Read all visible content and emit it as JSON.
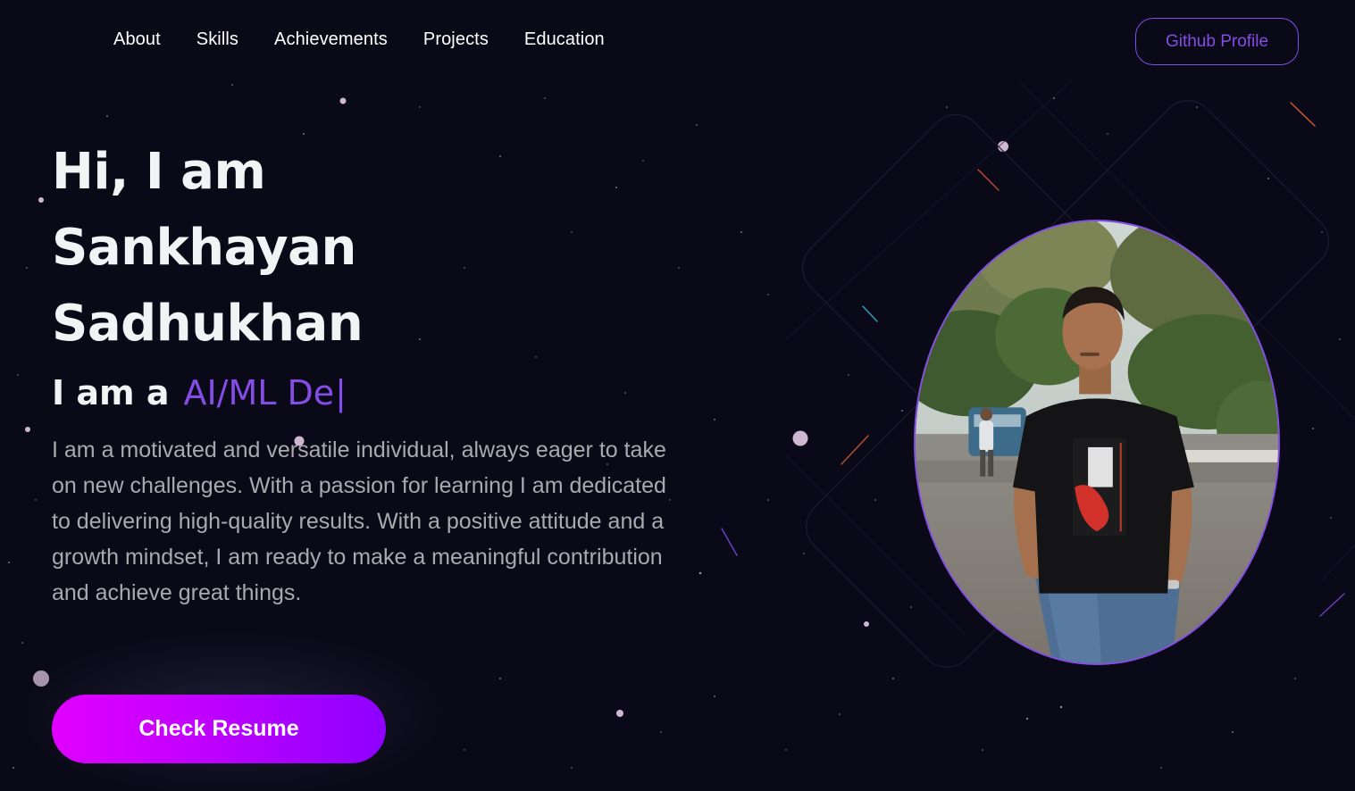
{
  "nav": {
    "links": [
      {
        "label": "About"
      },
      {
        "label": "Skills"
      },
      {
        "label": "Achievements"
      },
      {
        "label": "Projects"
      },
      {
        "label": "Education"
      }
    ],
    "github_label": "Github Profile"
  },
  "hero": {
    "title_lines": [
      "Hi, I am",
      "Sankhayan",
      "Sadhukhan"
    ],
    "role_prefix": "I am a",
    "role_typed": "AI/ML De",
    "cursor": "|",
    "description": "I am a motivated and versatile individual, always eager to take on new challenges. With a passion for learning I am dedicated to delivering high-quality results. With a positive attitude and a growth mindset, I am ready to make a meaningful contribution and achieve great things.",
    "resume_label": "Check Resume"
  },
  "colors": {
    "background": "#090917",
    "accent": "#854ce6",
    "text_primary": "#f2f3f4",
    "text_secondary": "#a9a9ae",
    "button_gradient_start": "#e100ff",
    "button_gradient_end": "#8e00ff"
  }
}
